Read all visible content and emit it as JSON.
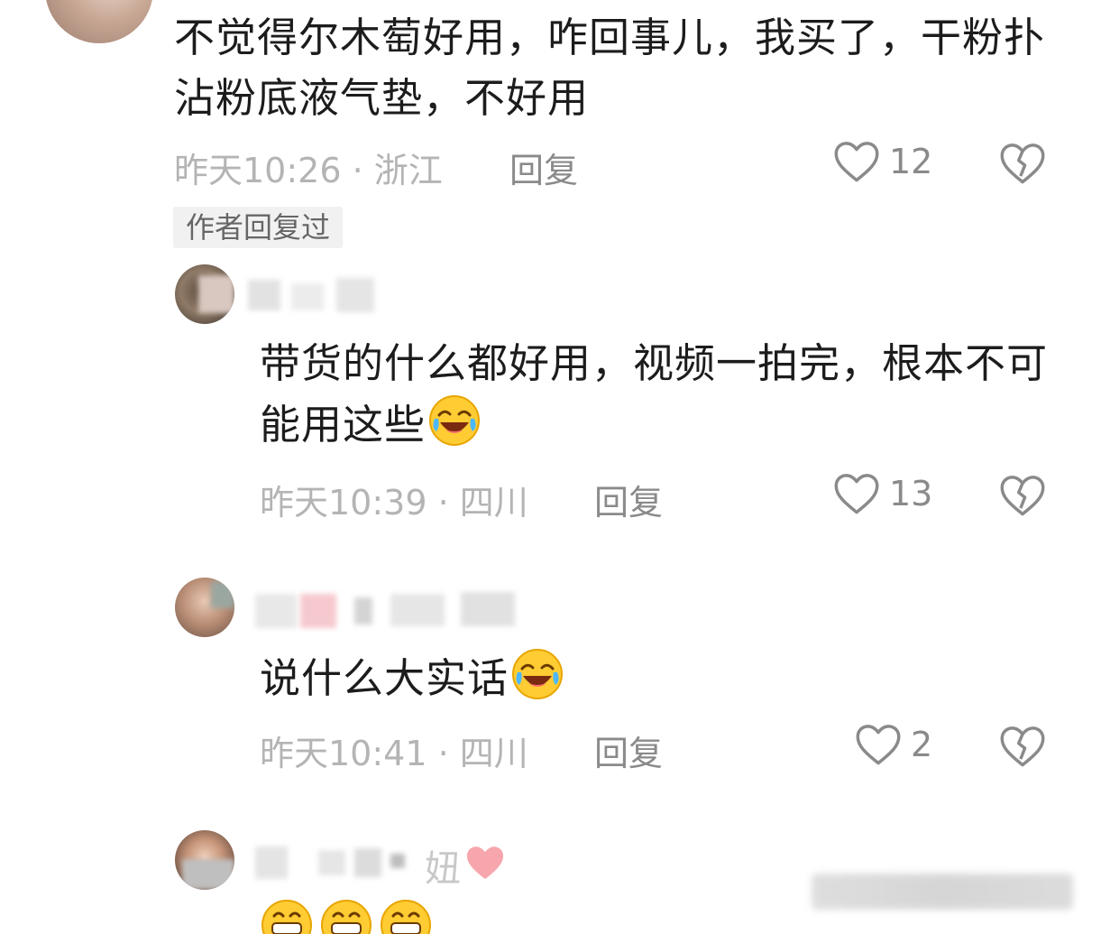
{
  "comments": {
    "top": {
      "text": "不觉得尔木萄好用，咋回事儿，我买了，干粉扑沾粉底液气垫，不好用",
      "time": "昨天10:26",
      "location": "浙江",
      "reply_label": "回复",
      "likes": "12",
      "author_tag": "作者回复过"
    },
    "replies": [
      {
        "text": "带货的什么都好用，视频一拍完，根本不可能用这些",
        "time": "昨天10:39",
        "location": "四川",
        "reply_label": "回复",
        "likes": "13"
      },
      {
        "text": "说什么大实话",
        "time": "昨天10:41",
        "location": "四川",
        "reply_label": "回复",
        "likes": "2"
      },
      {
        "name_suffix": "妞"
      }
    ]
  },
  "colors": {
    "meta": "#b4b4b4",
    "action": "#8a8a8a",
    "text": "#1c1c1c",
    "heart_emoji": "#f7a6ad"
  },
  "icons": {
    "like": "heart-outline-icon",
    "dislike": "broken-heart-icon",
    "emoji": "laughing-crying-emoji-icon",
    "grin": "grinning-emoji-icon"
  }
}
